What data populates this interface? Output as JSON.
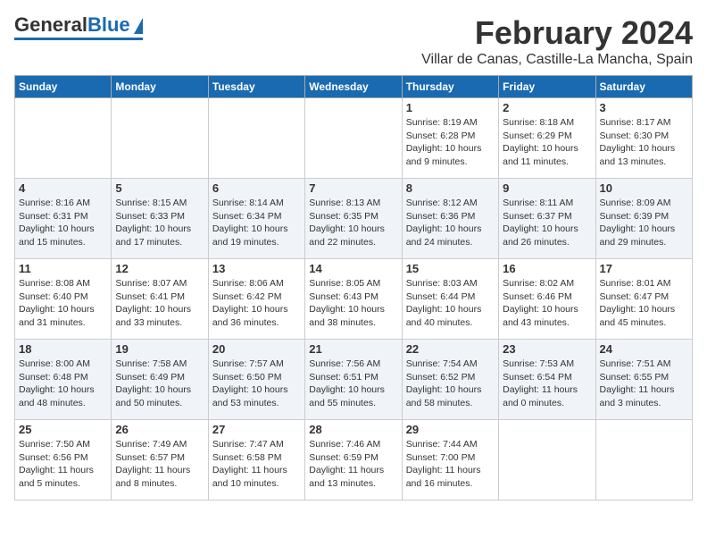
{
  "logo": {
    "line1": "General",
    "line2": "Blue"
  },
  "header": {
    "month": "February 2024",
    "location": "Villar de Canas, Castille-La Mancha, Spain"
  },
  "weekdays": [
    "Sunday",
    "Monday",
    "Tuesday",
    "Wednesday",
    "Thursday",
    "Friday",
    "Saturday"
  ],
  "weeks": [
    [
      {
        "day": "",
        "info": ""
      },
      {
        "day": "",
        "info": ""
      },
      {
        "day": "",
        "info": ""
      },
      {
        "day": "",
        "info": ""
      },
      {
        "day": "1",
        "info": "Sunrise: 8:19 AM\nSunset: 6:28 PM\nDaylight: 10 hours\nand 9 minutes."
      },
      {
        "day": "2",
        "info": "Sunrise: 8:18 AM\nSunset: 6:29 PM\nDaylight: 10 hours\nand 11 minutes."
      },
      {
        "day": "3",
        "info": "Sunrise: 8:17 AM\nSunset: 6:30 PM\nDaylight: 10 hours\nand 13 minutes."
      }
    ],
    [
      {
        "day": "4",
        "info": "Sunrise: 8:16 AM\nSunset: 6:31 PM\nDaylight: 10 hours\nand 15 minutes."
      },
      {
        "day": "5",
        "info": "Sunrise: 8:15 AM\nSunset: 6:33 PM\nDaylight: 10 hours\nand 17 minutes."
      },
      {
        "day": "6",
        "info": "Sunrise: 8:14 AM\nSunset: 6:34 PM\nDaylight: 10 hours\nand 19 minutes."
      },
      {
        "day": "7",
        "info": "Sunrise: 8:13 AM\nSunset: 6:35 PM\nDaylight: 10 hours\nand 22 minutes."
      },
      {
        "day": "8",
        "info": "Sunrise: 8:12 AM\nSunset: 6:36 PM\nDaylight: 10 hours\nand 24 minutes."
      },
      {
        "day": "9",
        "info": "Sunrise: 8:11 AM\nSunset: 6:37 PM\nDaylight: 10 hours\nand 26 minutes."
      },
      {
        "day": "10",
        "info": "Sunrise: 8:09 AM\nSunset: 6:39 PM\nDaylight: 10 hours\nand 29 minutes."
      }
    ],
    [
      {
        "day": "11",
        "info": "Sunrise: 8:08 AM\nSunset: 6:40 PM\nDaylight: 10 hours\nand 31 minutes."
      },
      {
        "day": "12",
        "info": "Sunrise: 8:07 AM\nSunset: 6:41 PM\nDaylight: 10 hours\nand 33 minutes."
      },
      {
        "day": "13",
        "info": "Sunrise: 8:06 AM\nSunset: 6:42 PM\nDaylight: 10 hours\nand 36 minutes."
      },
      {
        "day": "14",
        "info": "Sunrise: 8:05 AM\nSunset: 6:43 PM\nDaylight: 10 hours\nand 38 minutes."
      },
      {
        "day": "15",
        "info": "Sunrise: 8:03 AM\nSunset: 6:44 PM\nDaylight: 10 hours\nand 40 minutes."
      },
      {
        "day": "16",
        "info": "Sunrise: 8:02 AM\nSunset: 6:46 PM\nDaylight: 10 hours\nand 43 minutes."
      },
      {
        "day": "17",
        "info": "Sunrise: 8:01 AM\nSunset: 6:47 PM\nDaylight: 10 hours\nand 45 minutes."
      }
    ],
    [
      {
        "day": "18",
        "info": "Sunrise: 8:00 AM\nSunset: 6:48 PM\nDaylight: 10 hours\nand 48 minutes."
      },
      {
        "day": "19",
        "info": "Sunrise: 7:58 AM\nSunset: 6:49 PM\nDaylight: 10 hours\nand 50 minutes."
      },
      {
        "day": "20",
        "info": "Sunrise: 7:57 AM\nSunset: 6:50 PM\nDaylight: 10 hours\nand 53 minutes."
      },
      {
        "day": "21",
        "info": "Sunrise: 7:56 AM\nSunset: 6:51 PM\nDaylight: 10 hours\nand 55 minutes."
      },
      {
        "day": "22",
        "info": "Sunrise: 7:54 AM\nSunset: 6:52 PM\nDaylight: 10 hours\nand 58 minutes."
      },
      {
        "day": "23",
        "info": "Sunrise: 7:53 AM\nSunset: 6:54 PM\nDaylight: 11 hours\nand 0 minutes."
      },
      {
        "day": "24",
        "info": "Sunrise: 7:51 AM\nSunset: 6:55 PM\nDaylight: 11 hours\nand 3 minutes."
      }
    ],
    [
      {
        "day": "25",
        "info": "Sunrise: 7:50 AM\nSunset: 6:56 PM\nDaylight: 11 hours\nand 5 minutes."
      },
      {
        "day": "26",
        "info": "Sunrise: 7:49 AM\nSunset: 6:57 PM\nDaylight: 11 hours\nand 8 minutes."
      },
      {
        "day": "27",
        "info": "Sunrise: 7:47 AM\nSunset: 6:58 PM\nDaylight: 11 hours\nand 10 minutes."
      },
      {
        "day": "28",
        "info": "Sunrise: 7:46 AM\nSunset: 6:59 PM\nDaylight: 11 hours\nand 13 minutes."
      },
      {
        "day": "29",
        "info": "Sunrise: 7:44 AM\nSunset: 7:00 PM\nDaylight: 11 hours\nand 16 minutes."
      },
      {
        "day": "",
        "info": ""
      },
      {
        "day": "",
        "info": ""
      }
    ]
  ]
}
